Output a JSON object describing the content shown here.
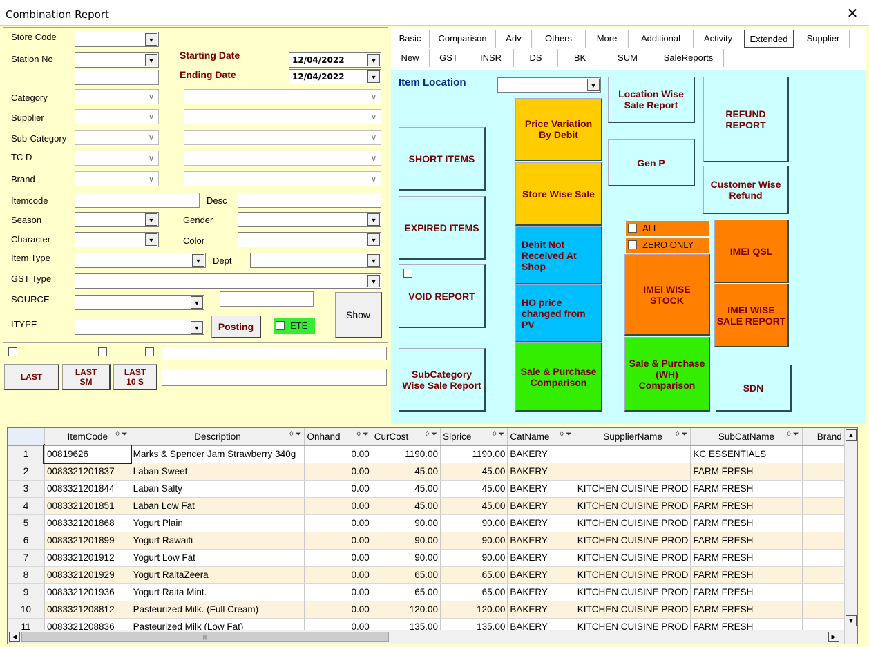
{
  "window": {
    "title": "Combination Report",
    "close": "✕"
  },
  "filters": {
    "store_code": "Store Code",
    "station_no": "Station No",
    "starting_date_label": "Starting Date",
    "ending_date_label": "Ending Date",
    "starting_date": "12/04/2022",
    "ending_date": "12/04/2022",
    "category": "Category",
    "supplier": "Supplier",
    "sub_category": "Sub-Category",
    "tcd": "TC D",
    "brand": "Brand",
    "itemcode": "Itemcode",
    "desc": "Desc",
    "season": "Season",
    "gender": "Gender",
    "character": "Character",
    "color": "Color",
    "item_type": "Item Type",
    "dept": "Dept",
    "gst_type": "GST Type",
    "source": "SOURCE",
    "itype": "ITYPE",
    "posting": "Posting",
    "ete": "ETE",
    "show": "Show",
    "last": "LAST",
    "last_sm_1": "LAST",
    "last_sm_2": "SM",
    "last_10s_1": "LAST",
    "last_10s_2": "10 S"
  },
  "tabs_row1": [
    "Basic",
    "Comparison",
    "Adv",
    "Others",
    "More",
    "Additional",
    "Activity",
    "Extended",
    "Supplier"
  ],
  "tabs_row2": [
    "New",
    "GST",
    "INSR",
    "DS",
    "BK",
    "SUM",
    "SaleReports"
  ],
  "selected_tab": "Extended",
  "extended": {
    "item_location": "Item Location",
    "location_wise": "Location Wise Sale Report",
    "refund_report": "REFUND REPORT",
    "price_variation": "Price Variation By Debit",
    "short_items": "SHORT ITEMS",
    "gen_p": "Gen P",
    "store_wise_sale": "Store Wise Sale",
    "customer_wise_refund": "Customer Wise Refund",
    "expired_items": "EXPIRED ITEMS",
    "all": "ALL",
    "zero_only": "ZERO ONLY",
    "imei_qsl": "IMEI QSL",
    "debit_not_received": "Debit Not Received At Shop",
    "imei_wise_stock": "IMEI WISE STOCK",
    "void_report": "VOID REPORT",
    "ho_price_changed": "HO price changed from PV",
    "imei_wise_sale": "IMEI WISE SALE REPORT",
    "subcategory_wise": "SubCategory Wise Sale Report",
    "sale_purchase_comparison": "Sale & Purchase Comparison",
    "sale_purchase_wh": "Sale & Purchase (WH) Comparison",
    "sdn": "SDN"
  },
  "colors": {
    "panel": "#ffffcc",
    "cyan": "#ccffff",
    "yellow": "#ffcc00",
    "blue": "#00bfff",
    "green": "#33ee00",
    "orange": "#ff8000",
    "label_red": "#7a0000"
  },
  "grid": {
    "columns": [
      "ItemCode",
      "Description",
      "Onhand",
      "CurCost",
      "Slprice",
      "CatName",
      "SupplierName",
      "SubCatName",
      "Brand"
    ],
    "rows": [
      [
        "1",
        "00819626",
        "Marks & Spencer Jam Strawberry 340g",
        "0.00",
        "1190.00",
        "1190.00",
        "BAKERY",
        "",
        "KC ESSENTIALS"
      ],
      [
        "2",
        "0083321201837",
        "Laban Sweet",
        "0.00",
        "45.00",
        "45.00",
        "BAKERY",
        "",
        "FARM FRESH"
      ],
      [
        "3",
        "0083321201844",
        "Laban Salty",
        "0.00",
        "45.00",
        "45.00",
        "BAKERY",
        "KITCHEN CUISINE PROD",
        "FARM FRESH"
      ],
      [
        "4",
        "0083321201851",
        "Laban Low Fat",
        "0.00",
        "45.00",
        "45.00",
        "BAKERY",
        "KITCHEN CUISINE PROD",
        "FARM FRESH"
      ],
      [
        "5",
        "0083321201868",
        "Yogurt Plain",
        "0.00",
        "90.00",
        "90.00",
        "BAKERY",
        "KITCHEN CUISINE PROD",
        "FARM FRESH"
      ],
      [
        "6",
        "0083321201899",
        "Yogurt Rawaiti",
        "0.00",
        "90.00",
        "90.00",
        "BAKERY",
        "KITCHEN CUISINE PROD",
        "FARM FRESH"
      ],
      [
        "7",
        "0083321201912",
        "Yogurt Low Fat",
        "0.00",
        "90.00",
        "90.00",
        "BAKERY",
        "KITCHEN CUISINE PROD",
        "FARM FRESH"
      ],
      [
        "8",
        "0083321201929",
        "Yogurt RaitaZeera",
        "0.00",
        "65.00",
        "65.00",
        "BAKERY",
        "KITCHEN CUISINE PROD",
        "FARM FRESH"
      ],
      [
        "9",
        "0083321201936",
        "Yogurt Raita Mint.",
        "0.00",
        "65.00",
        "65.00",
        "BAKERY",
        "KITCHEN CUISINE PROD",
        "FARM FRESH"
      ],
      [
        "10",
        "0083321208812",
        "Pasteurized Milk. (Full Cream)",
        "0.00",
        "120.00",
        "120.00",
        "BAKERY",
        "KITCHEN CUISINE PROD",
        "FARM FRESH"
      ],
      [
        "11",
        "0083321208836",
        "Pasteurized Milk (Low Fat)",
        "0.00",
        "135.00",
        "135.00",
        "BAKERY",
        "KITCHEN CUISINE PROD",
        "FARM FRESH"
      ]
    ]
  }
}
